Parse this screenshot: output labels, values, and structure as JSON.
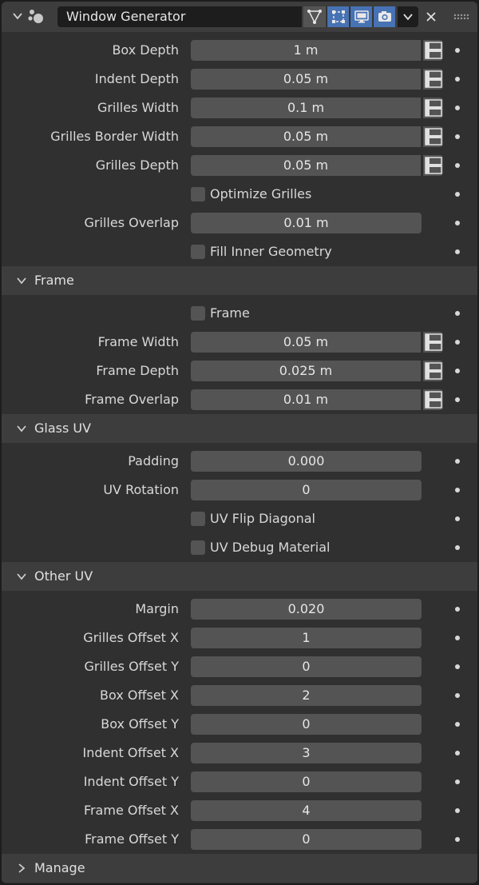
{
  "header": {
    "modifier_name": "Window Generator",
    "icons": {
      "collapse": "chevron-down-icon",
      "modifier": "modifier-type-icon",
      "edit_mode": "edit-mode-triangle-icon",
      "cage": "on-cage-icon",
      "viewport": "monitor-icon",
      "render": "camera-icon",
      "dropdown": "chevron-down-icon",
      "close": "close-icon",
      "drag": "drag-handle-icon"
    },
    "active_color": "#4772b3"
  },
  "rows_top": [
    {
      "label": "Box Depth",
      "value": "1 m"
    },
    {
      "label": "Indent Depth",
      "value": "0.05 m"
    },
    {
      "label": "Grilles Width",
      "value": "0.1 m"
    },
    {
      "label": "Grilles Border Width",
      "value": "0.05 m"
    },
    {
      "label": "Grilles Depth",
      "value": "0.05 m"
    }
  ],
  "optimize_grilles": {
    "label": "Optimize Grilles",
    "checked": false
  },
  "grilles_overlap": {
    "label": "Grilles Overlap",
    "value": "0.01 m"
  },
  "fill_inner_geometry": {
    "label": "Fill Inner Geometry",
    "checked": false
  },
  "frame_section": {
    "title": "Frame",
    "frame_toggle": {
      "label": "Frame",
      "checked": false
    },
    "rows": [
      {
        "label": "Frame Width",
        "value": "0.05 m"
      },
      {
        "label": "Frame Depth",
        "value": "0.025 m"
      },
      {
        "label": "Frame Overlap",
        "value": "0.01 m"
      }
    ]
  },
  "glass_uv_section": {
    "title": "Glass UV",
    "padding": {
      "label": "Padding",
      "value": "0.000"
    },
    "uv_rotation": {
      "label": "UV Rotation",
      "value": "0"
    },
    "uv_flip_diagonal": {
      "label": "UV Flip Diagonal",
      "checked": false
    },
    "uv_debug_material": {
      "label": "UV Debug Material",
      "checked": false
    }
  },
  "other_uv_section": {
    "title": "Other UV",
    "rows": [
      {
        "label": "Margin",
        "value": "0.020"
      },
      {
        "label": "Grilles Offset X",
        "value": "1"
      },
      {
        "label": "Grilles Offset Y",
        "value": "0"
      },
      {
        "label": "Box Offset X",
        "value": "2"
      },
      {
        "label": "Box Offset Y",
        "value": "0"
      },
      {
        "label": "Indent Offset X",
        "value": "3"
      },
      {
        "label": "Indent Offset Y",
        "value": "0"
      },
      {
        "label": "Frame Offset X",
        "value": "4"
      },
      {
        "label": "Frame Offset Y",
        "value": "0"
      }
    ]
  },
  "manage_section": {
    "title": "Manage",
    "expanded": false
  }
}
